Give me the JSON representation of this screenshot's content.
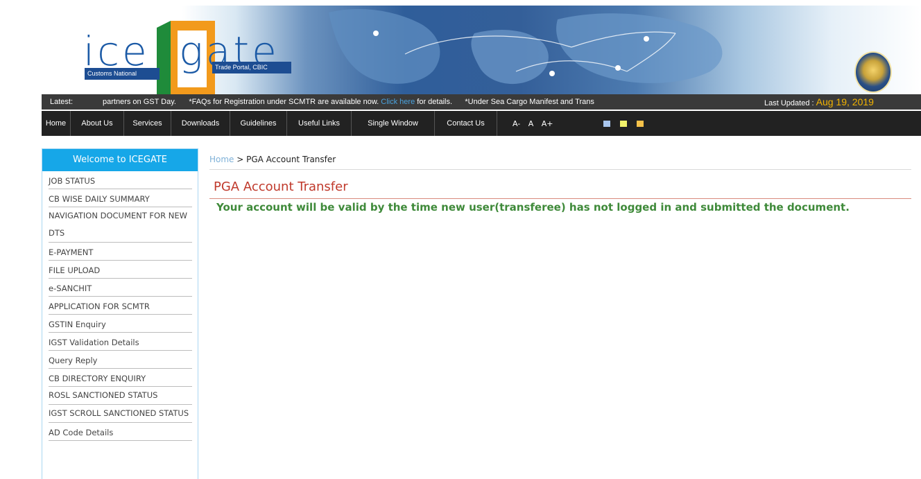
{
  "logo": {
    "ice": "ice",
    "gate": "gate",
    "left_tag": "Customs National",
    "right_tag": "Trade Portal, CBIC"
  },
  "ticker": {
    "latest_label": "Latest:",
    "item1": "partners on GST Day.",
    "item2": "*FAQs for Registration under SCMTR are available now.",
    "item2_link": "Click here",
    "item2_tail": "for details.",
    "item3": "*Under Sea Cargo Manifest and Trans",
    "updated_label": "Last Updated :",
    "updated_date": "Aug 19, 2019"
  },
  "menu": {
    "items": [
      "Home",
      "About Us",
      "Services",
      "Downloads",
      "Guidelines",
      "Useful Links",
      "Single Window",
      "Contact Us"
    ],
    "font_sizes": "A-  A  A+",
    "swatch_colors": [
      "#a9c6ee",
      "#f2f26a",
      "#f5c24a"
    ]
  },
  "sidebar": {
    "header": "Welcome to ICEGATE",
    "items": [
      "JOB STATUS",
      "CB WISE DAILY SUMMARY",
      "NAVIGATION DOCUMENT FOR NEW DTS",
      "E-PAYMENT",
      "FILE UPLOAD",
      "e-SANCHIT",
      "APPLICATION FOR SCMTR",
      "GSTIN Enquiry",
      "IGST Validation Details",
      "Query Reply",
      "CB DIRECTORY ENQUIRY",
      "ROSL SANCTIONED STATUS",
      "IGST SCROLL SANCTIONED STATUS",
      "AD Code Details"
    ]
  },
  "content": {
    "breadcrumb_home": "Home",
    "breadcrumb_sep": " > ",
    "breadcrumb_current": "PGA Account Transfer",
    "title": "PGA Account Transfer",
    "message": "Your account will be valid by the time new user(transferee) has not logged in and submitted the document."
  }
}
